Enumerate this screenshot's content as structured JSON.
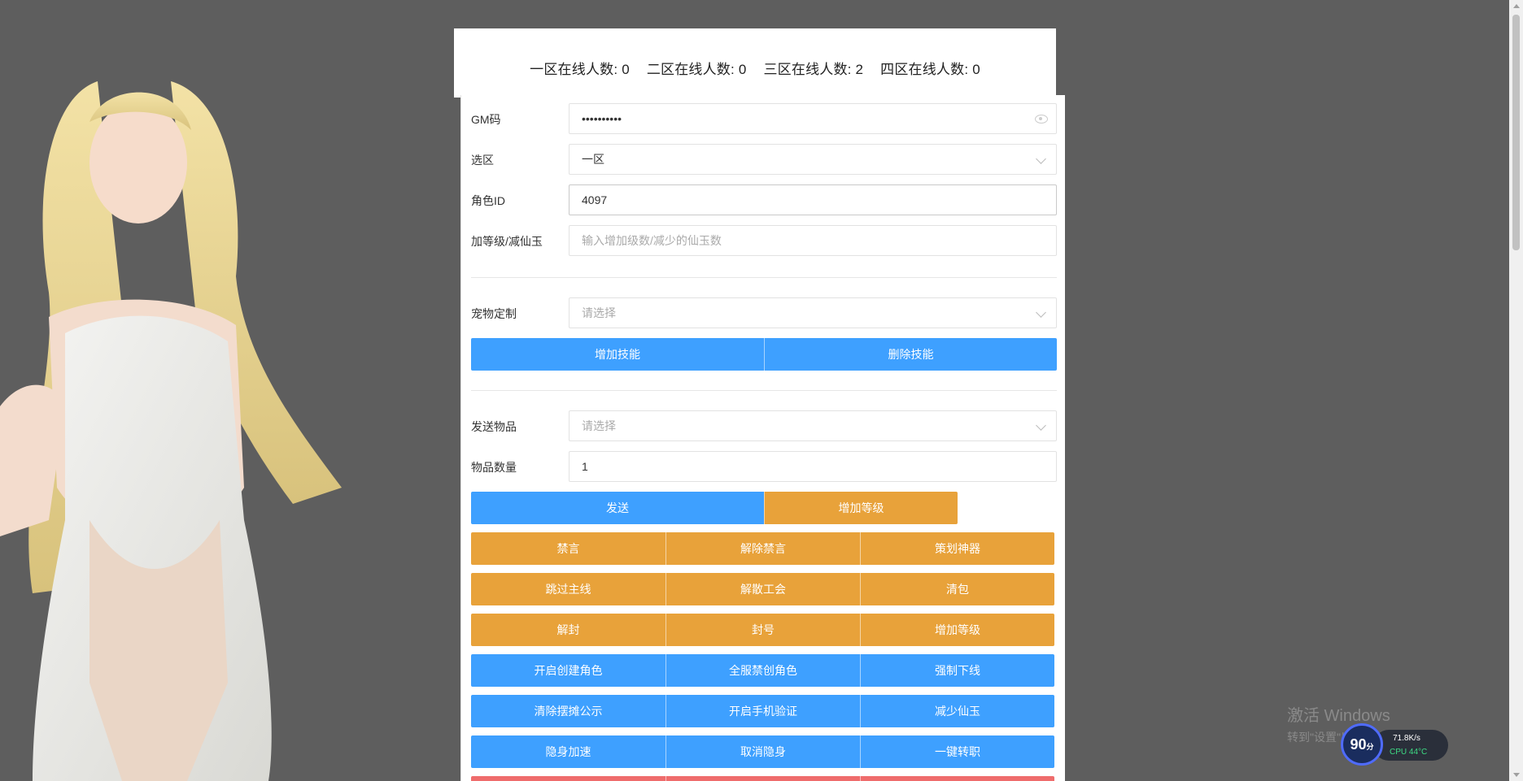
{
  "online": {
    "zone1_label": "一区在线人数:",
    "zone1_count": "0",
    "zone2_label": "二区在线人数:",
    "zone2_count": "0",
    "zone3_label": "三区在线人数:",
    "zone3_count": "2",
    "zone4_label": "四区在线人数:",
    "zone4_count": "0"
  },
  "form": {
    "gm_code": {
      "label": "GM码",
      "value": "••••••••••"
    },
    "zone": {
      "label": "选区",
      "value": "一区"
    },
    "role_id": {
      "label": "角色ID",
      "value": "4097"
    },
    "level_jade": {
      "label": "加等级/减仙玉",
      "placeholder": "输入增加级数/减少的仙玉数"
    },
    "pet": {
      "label": "宠物定制",
      "placeholder": "请选择"
    },
    "item": {
      "label": "发送物品",
      "placeholder": "请选择"
    },
    "item_qty": {
      "label": "物品数量",
      "value": "1"
    }
  },
  "buttons": {
    "add_skill": "增加技能",
    "remove_skill": "删除技能",
    "send": "发送",
    "add_level_1": "增加等级",
    "mute": "禁言",
    "unmute": "解除禁言",
    "planner_artifact": "策划神器",
    "skip_mainline": "跳过主线",
    "disband_guild": "解散工会",
    "clear_bag": "清包",
    "unban": "解封",
    "ban": "封号",
    "add_level_2": "增加等级",
    "enable_create_role": "开启创建角色",
    "server_ban_create": "全服禁创角色",
    "force_offline": "强制下线",
    "clear_stall_notice": "清除摆摊公示",
    "enable_phone_verify": "开启手机验证",
    "reduce_jade": "减少仙玉",
    "stealth_speed": "隐身加速",
    "cancel_stealth": "取消隐身",
    "one_click_transfer": "一键转职"
  },
  "watermark": {
    "title": "激活 Windows",
    "subtitle": "转到\"设置\"以激活 Windows。"
  },
  "perf": {
    "score": "90",
    "score_unit": "分",
    "net": "71.8K/s",
    "cpu": "CPU 44°C"
  },
  "colors": {
    "blue": "#3ea0ff",
    "orange": "#e8a23a",
    "red": "#ef6c6c"
  }
}
